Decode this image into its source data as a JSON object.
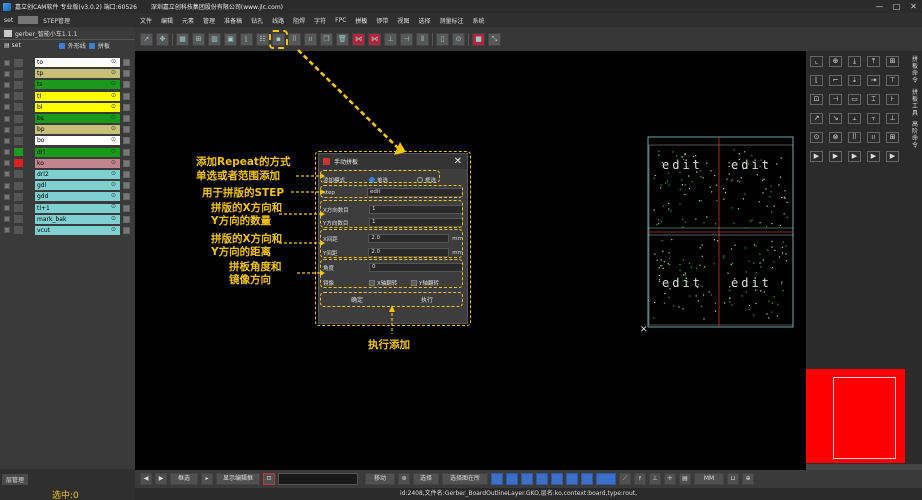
{
  "app": {
    "title": "嘉立创CAM软件 专业版(v3.0.2) 端口:60526",
    "company": "深圳嘉立创科技集团股份有限公司(www.jlc.com)"
  },
  "left_panel": {
    "tab_set": "set",
    "tab_step": "STEP管理",
    "path": "gerber_智能小车1.1.1",
    "head_set": "set",
    "head_outline": "外形线",
    "head_panel": "拼板",
    "layers": [
      {
        "name": "to",
        "color": "#ffffff",
        "swatch": "#555555"
      },
      {
        "name": "tp",
        "color": "#c8c07a",
        "swatch": "#555555"
      },
      {
        "name": "ts",
        "color": "#1a9a1a",
        "swatch": "#555555"
      },
      {
        "name": "tl",
        "color": "#ffff00",
        "swatch": "#555555"
      },
      {
        "name": "bl",
        "color": "#ffff00",
        "swatch": "#555555"
      },
      {
        "name": "bs",
        "color": "#1a9a1a",
        "swatch": "#555555"
      },
      {
        "name": "bp",
        "color": "#c8c07a",
        "swatch": "#555555"
      },
      {
        "name": "bo",
        "color": "#ffffff",
        "swatch": "#555555"
      },
      {
        "name": "drl",
        "color": "#1a9a1a",
        "swatch": "#1f9a1f"
      },
      {
        "name": "ko",
        "color": "#c0858f",
        "swatch": "#e02020"
      },
      {
        "name": "drl2",
        "color": "#7fd1d1",
        "swatch": "#555555"
      },
      {
        "name": "gdl",
        "color": "#7fd1d1",
        "swatch": "#555555"
      },
      {
        "name": "gdd",
        "color": "#7fd1d1",
        "swatch": "#555555"
      },
      {
        "name": "tl+1",
        "color": "#7fd1d1",
        "swatch": "#555555"
      },
      {
        "name": "mark_bak",
        "color": "#7fd1d1",
        "swatch": "#555555"
      },
      {
        "name": "vcut",
        "color": "#7fd1d1",
        "swatch": "#555555"
      }
    ],
    "footer_button": "层管理",
    "selected": "选中:0"
  },
  "menu": [
    "文件",
    "编辑",
    "元素",
    "管理",
    "准备稿",
    "钻孔",
    "线路",
    "阻焊",
    "字符",
    "FPC",
    "拼板",
    "锣带",
    "视图",
    "选择",
    "测量标注",
    "系统"
  ],
  "menu_active": "拼板",
  "dialog": {
    "title": "手动拼板",
    "mode_label": "添加模式",
    "mode_opt1": "单选",
    "mode_opt2": "框选",
    "step_label": "step",
    "step_value": "edit",
    "x_count_label": "X方向数目",
    "x_count": "1",
    "y_count_label": "Y方向数目",
    "y_count": "1",
    "x_gap_label": "X间距",
    "x_gap": "2.0",
    "y_gap_label": "Y间距",
    "y_gap": "2.0",
    "unit": "mm",
    "angle_label": "角度",
    "angle_value": "0",
    "mirror_label": "镜像",
    "mirror_x": "X轴翻转",
    "mirror_y": "Y轴翻转",
    "ok": "确定",
    "exec": "执行"
  },
  "annotations": {
    "a1_line1": "添加Repeat的方式",
    "a1_line2": "单选或者范围添加",
    "a2": "用于拼版的STEP",
    "a3_line1": "拼版的X方向和",
    "a3_line2": "Y方向的数量",
    "a4_line1": "拼版的X方向和",
    "a4_line2": "Y方向的距离",
    "a5_line1": "拼板角度和",
    "a5_line2": "镜像方向",
    "a6": "执行添加"
  },
  "board_text": "edit",
  "right_panel": {
    "tab1": "拼板命令",
    "tab2": "拼板工具",
    "tab3": "高阶命令"
  },
  "bottom_bar": {
    "mode": "框选",
    "display_editor": "显示编辑框",
    "move": "移动",
    "select": "选择",
    "select_all": "选择图在所",
    "unit": "MM"
  },
  "status_text": "id:2408,文件名:Gerber_BoardOutlineLayer.GKO,层名:ko,context:board,type:rout,"
}
